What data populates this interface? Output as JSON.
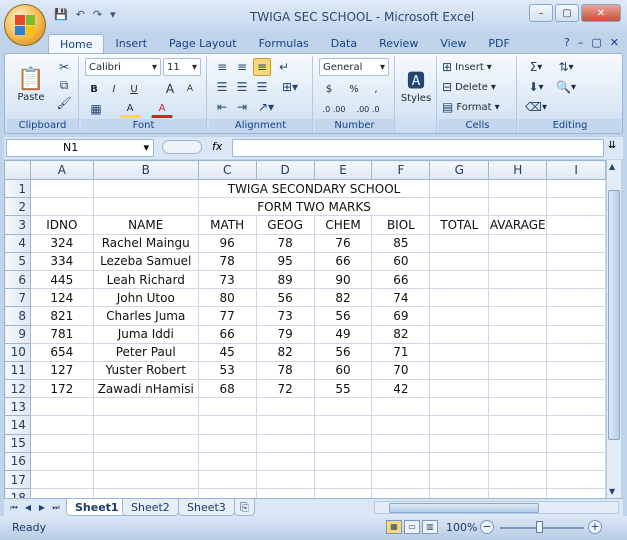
{
  "window": {
    "title": "TWIGA SEC SCHOOL  -  Microsoft Excel",
    "qat": [
      "💾",
      "↶",
      "↷",
      "▾"
    ],
    "controls": [
      "–",
      "▢",
      "✕"
    ]
  },
  "ribbon": {
    "tabs": [
      "Home",
      "Insert",
      "Page Layout",
      "Formulas",
      "Data",
      "Review",
      "View",
      "PDF"
    ],
    "active_tab": "Home",
    "right_icons": [
      "?",
      "–",
      "▢",
      "✕"
    ],
    "clipboard": {
      "label": "Clipboard",
      "paste": "Paste"
    },
    "font": {
      "label": "Font",
      "name": "Calibri",
      "size": "11",
      "bold": "B",
      "italic": "I",
      "underline": "U",
      "grow": "A",
      "shrink": "A",
      "fill": "A",
      "color": "A"
    },
    "alignment": {
      "label": "Alignment"
    },
    "number": {
      "label": "Number",
      "format": "General",
      "currency": "$",
      "percent": "%",
      "comma": ",",
      "inc_dec": ".0 .00",
      "dec_dec": ".00 .0"
    },
    "styles": {
      "label": "Styles"
    },
    "cells": {
      "label": "Cells",
      "insert": "Insert",
      "delete": "Delete",
      "format": "Format"
    },
    "editing": {
      "label": "Editing",
      "sum": "Σ"
    }
  },
  "formula_bar": {
    "name_box": "N1",
    "fx": "fx",
    "value": ""
  },
  "grid": {
    "columns": [
      "A",
      "B",
      "C",
      "D",
      "E",
      "F",
      "G",
      "H",
      "I"
    ],
    "rows": [
      {
        "n": "1",
        "cells": [
          "",
          "",
          "TWIGA SECONDARY  SCHOOL",
          "",
          "",
          "",
          "",
          "",
          ""
        ]
      },
      {
        "n": "2",
        "cells": [
          "",
          "",
          "FORM TWO MARKS",
          "",
          "",
          "",
          "",
          "",
          ""
        ]
      },
      {
        "n": "3",
        "cells": [
          "IDNO",
          "NAME",
          "MATH",
          "GEOG",
          "CHEM",
          "BIOL",
          "TOTAL",
          "AVARAGE",
          ""
        ]
      },
      {
        "n": "4",
        "cells": [
          "324",
          "Rachel Maingu",
          "96",
          "78",
          "76",
          "85",
          "",
          "",
          ""
        ]
      },
      {
        "n": "5",
        "cells": [
          "334",
          "Lezeba Samuel",
          "78",
          "95",
          "66",
          "60",
          "",
          "",
          ""
        ]
      },
      {
        "n": "6",
        "cells": [
          "445",
          "Leah Richard",
          "73",
          "89",
          "90",
          "66",
          "",
          "",
          ""
        ]
      },
      {
        "n": "7",
        "cells": [
          "124",
          "John Utoo",
          "80",
          "56",
          "82",
          "74",
          "",
          "",
          ""
        ]
      },
      {
        "n": "8",
        "cells": [
          "821",
          "Charles Juma",
          "77",
          "73",
          "56",
          "69",
          "",
          "",
          ""
        ]
      },
      {
        "n": "9",
        "cells": [
          "781",
          "Juma Iddi",
          "66",
          "79",
          "49",
          "82",
          "",
          "",
          ""
        ]
      },
      {
        "n": "10",
        "cells": [
          "654",
          "Peter Paul",
          "45",
          "82",
          "56",
          "71",
          "",
          "",
          ""
        ]
      },
      {
        "n": "11",
        "cells": [
          "127",
          "Yuster Robert",
          "53",
          "78",
          "60",
          "70",
          "",
          "",
          ""
        ]
      },
      {
        "n": "12",
        "cells": [
          "172",
          "Zawadi nHamisi",
          "68",
          "72",
          "55",
          "42",
          "",
          "",
          ""
        ]
      },
      {
        "n": "13",
        "cells": [
          "",
          "",
          "",
          "",
          "",
          "",
          "",
          "",
          ""
        ]
      },
      {
        "n": "14",
        "cells": [
          "",
          "",
          "",
          "",
          "",
          "",
          "",
          "",
          ""
        ]
      },
      {
        "n": "15",
        "cells": [
          "",
          "",
          "",
          "",
          "",
          "",
          "",
          "",
          ""
        ]
      },
      {
        "n": "16",
        "cells": [
          "",
          "",
          "",
          "",
          "",
          "",
          "",
          "",
          ""
        ]
      },
      {
        "n": "17",
        "cells": [
          "",
          "",
          "",
          "",
          "",
          "",
          "",
          "",
          ""
        ]
      },
      {
        "n": "18",
        "cells": [
          "",
          "",
          "",
          "",
          "",
          "",
          "",
          "",
          ""
        ]
      }
    ]
  },
  "sheets": {
    "tabs": [
      "Sheet1",
      "Sheet2",
      "Sheet3"
    ],
    "active": "Sheet1",
    "nav": [
      "⏮",
      "◀",
      "▶",
      "⏭"
    ]
  },
  "status": {
    "text": "Ready",
    "zoom": "100%",
    "minus": "−",
    "plus": "+"
  }
}
